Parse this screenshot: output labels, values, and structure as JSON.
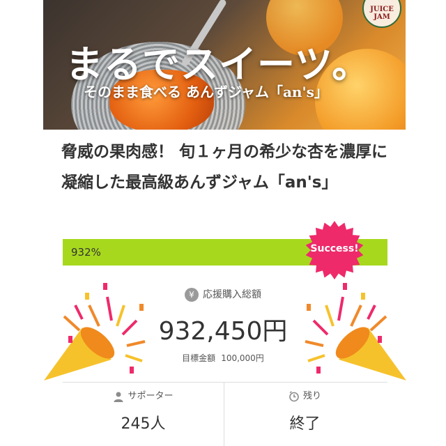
{
  "hero": {
    "title": "まるでスイーツ。",
    "subtitle": "そのまま食べる あんずジャム「an's」",
    "logo_text": "JUICE JAM"
  },
  "project": {
    "title": "脅威の果肉感！ 旬１ヶ月の希少な杏を濃厚に凝縮した最高級あんずジャム「an's」"
  },
  "progress": {
    "percent_label": "932%",
    "achieved_fraction": 1.0,
    "badge_label": "Success!",
    "bar_color": "#a7d81e",
    "badge_color": "#ee2a6b"
  },
  "totals": {
    "label": "応援購入総額",
    "icon": "yen-icon",
    "amount": "932,450円",
    "goal_label": "目標金額",
    "goal_value": "100,000円"
  },
  "stats": {
    "supporters_label": "サポーター",
    "supporters_icon": "person-icon",
    "supporters_value": "245人",
    "remaining_label": "残り",
    "remaining_icon": "clock-icon",
    "remaining_value": "終了"
  }
}
